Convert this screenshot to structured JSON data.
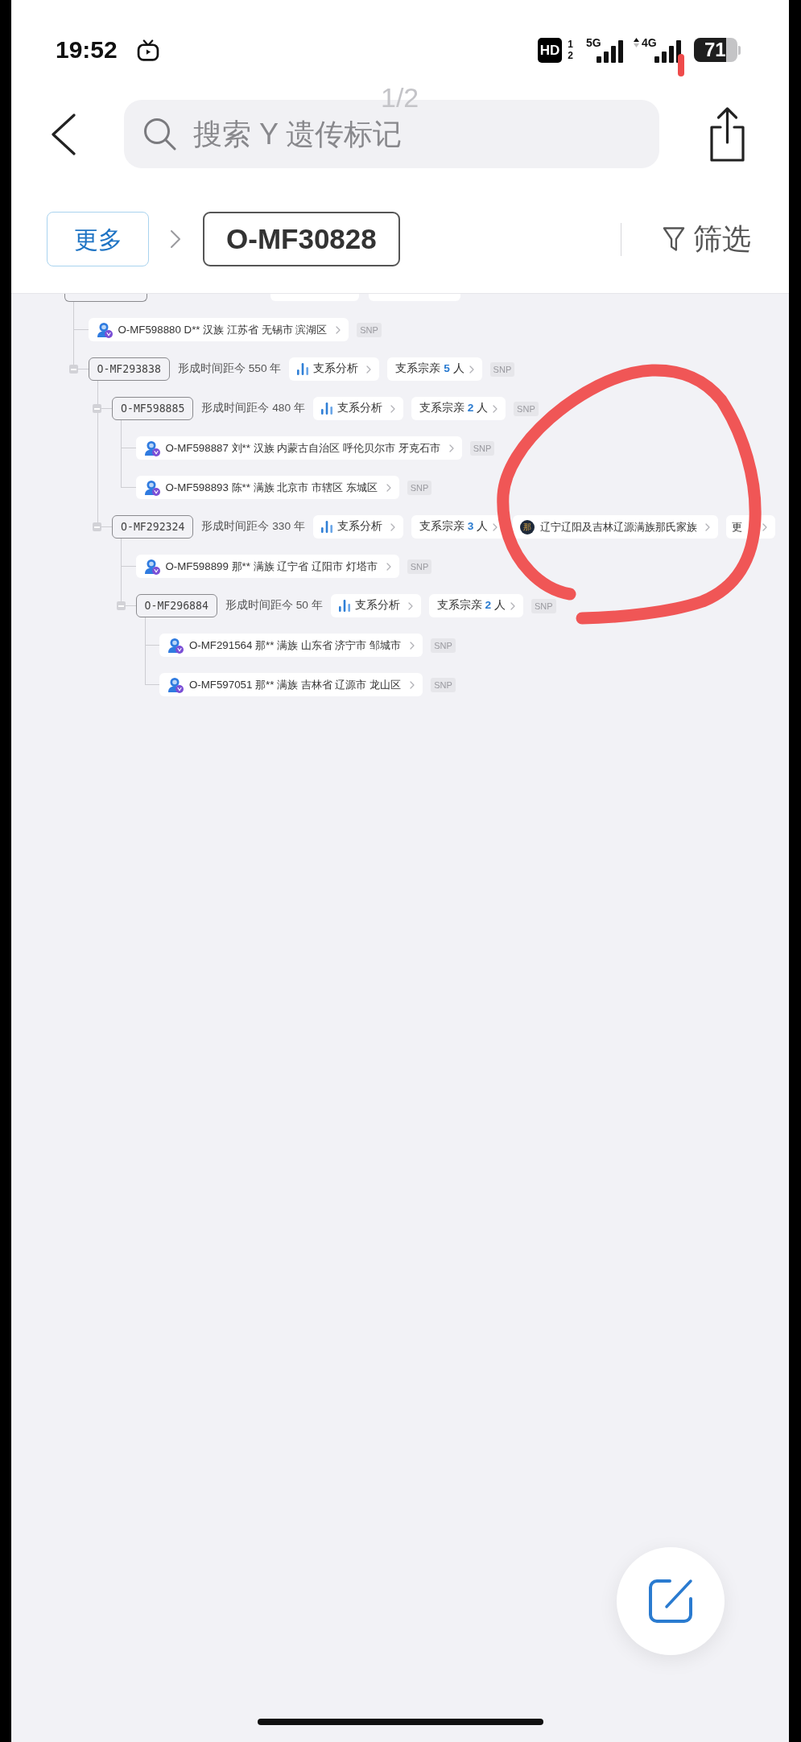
{
  "status_bar": {
    "time": "19:52",
    "hd": "HD",
    "sim_slots": [
      "1",
      "2"
    ],
    "network_5g": "5G",
    "network_4g": "4G",
    "battery": "71"
  },
  "page_indicator": "1/2",
  "search": {
    "placeholder": "搜索 Y 遗传标记"
  },
  "breadcrumb": {
    "more": "更多",
    "current": "O-MF30828"
  },
  "filter": {
    "label": "筛选"
  },
  "tree": {
    "children": [
      {
        "kind": "sample",
        "label": "O-MF598880 D** 汉族 江苏省 无锡市 滨湖区",
        "tag": "SNP"
      },
      {
        "kind": "branch",
        "id": "O-MF293838",
        "expanded": true,
        "age": "形成时间距今 550 年",
        "analysis": "支系分析",
        "relatives": {
          "label": "支系宗亲",
          "count": "5",
          "unit": "人"
        },
        "tag": "SNP",
        "children": [
          {
            "kind": "branch",
            "id": "O-MF598885",
            "expanded": true,
            "age": "形成时间距今 480 年",
            "analysis": "支系分析",
            "relatives": {
              "label": "支系宗亲",
              "count": "2",
              "unit": "人"
            },
            "tag": "SNP",
            "children": [
              {
                "kind": "sample",
                "label": "O-MF598887 刘** 汉族 内蒙古自治区 呼伦贝尔市 牙克石市",
                "tag": "SNP"
              },
              {
                "kind": "sample",
                "label": "O-MF598893 陈** 满族 北京市 市辖区 东城区",
                "tag": "SNP"
              }
            ]
          },
          {
            "kind": "branch",
            "id": "O-MF292324",
            "expanded": true,
            "age": "形成时间距今 330 年",
            "analysis": "支系分析",
            "relatives": {
              "label": "支系宗亲",
              "count": "3",
              "unit": "人"
            },
            "family": {
              "emblem": "那",
              "name": "辽宁辽阳及吉林辽源满族那氏家族"
            },
            "more": "更",
            "children": [
              {
                "kind": "sample",
                "label": "O-MF598899 那** 满族 辽宁省 辽阳市 灯塔市",
                "tag": "SNP"
              },
              {
                "kind": "branch",
                "id": "O-MF296884",
                "expanded": true,
                "age": "形成时间距今 50 年",
                "analysis": "支系分析",
                "relatives": {
                  "label": "支系宗亲",
                  "count": "2",
                  "unit": "人"
                },
                "tag": "SNP",
                "children": [
                  {
                    "kind": "sample",
                    "label": "O-MF291564 那** 满族 山东省 济宁市 邹城市",
                    "tag": "SNP"
                  },
                  {
                    "kind": "sample",
                    "label": "O-MF597051 那** 满族 吉林省 辽源市 龙山区",
                    "tag": "SNP"
                  }
                ]
              }
            ]
          }
        ]
      }
    ]
  }
}
